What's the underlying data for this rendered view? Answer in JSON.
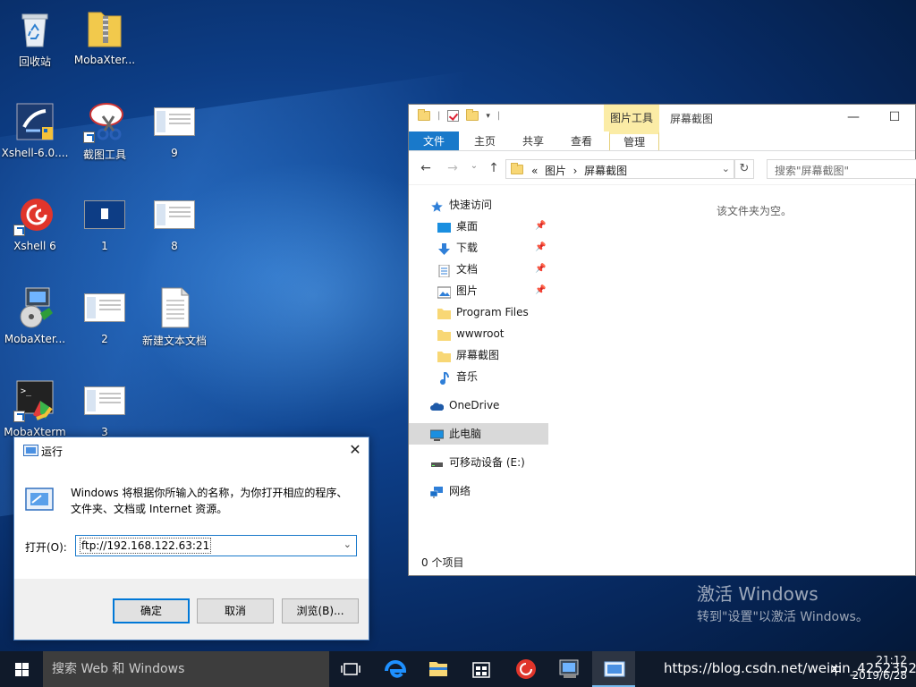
{
  "desktop": {
    "icons": [
      {
        "label": "回收站"
      },
      {
        "label": "MobaXter..."
      },
      {
        "label": "Xshell-6.0...."
      },
      {
        "label": "截图工具"
      },
      {
        "label": "9"
      },
      {
        "label": "Xshell 6"
      },
      {
        "label": "1"
      },
      {
        "label": "8"
      },
      {
        "label": "MobaXter..."
      },
      {
        "label": "2"
      },
      {
        "label": "新建文本文档"
      },
      {
        "label": "MobaXterm"
      },
      {
        "label": "3"
      }
    ]
  },
  "explorer": {
    "contextual_tab_header": "图片工具",
    "title": "屏幕截图",
    "ribbon_tabs": [
      "文件",
      "主页",
      "共享",
      "查看",
      "管理"
    ],
    "breadcrumb": [
      "«",
      "图片",
      "›",
      "屏幕截图"
    ],
    "search_placeholder": "搜索\"屏幕截图\"",
    "nav": {
      "quick_access": "快速访问",
      "desktop": "桌面",
      "downloads": "下载",
      "documents": "文档",
      "pictures": "图片",
      "program_files": "Program Files",
      "wwwroot": "wwwroot",
      "screenshots": "屏幕截图",
      "music": "音乐",
      "onedrive": "OneDrive",
      "this_pc": "此电脑",
      "removable": "可移动设备 (E:)",
      "network": "网络"
    },
    "empty_message": "该文件夹为空。",
    "status": "0 个项目"
  },
  "run_dialog": {
    "title": "运行",
    "description": "Windows 将根据你所输入的名称，为你打开相应的程序、文件夹、文档或 Internet 资源。",
    "open_label": "打开(O):",
    "input_value": "ftp://192.168.122.63:21",
    "ok": "确定",
    "cancel": "取消",
    "browse": "浏览(B)..."
  },
  "watermark": {
    "line1": "激活 Windows",
    "line2": "转到\"设置\"以激活 Windows。"
  },
  "taskbar": {
    "search_placeholder": "搜索 Web 和 Windows",
    "overlay_url": "https://blog.csdn.net/weixin_4252352",
    "ime": "中",
    "time": "21:12",
    "date": "2019/6/28"
  },
  "colors": {
    "accent": "#1979ca",
    "contextual_tab": "#fbeca6",
    "taskbar": "#101a2a"
  }
}
